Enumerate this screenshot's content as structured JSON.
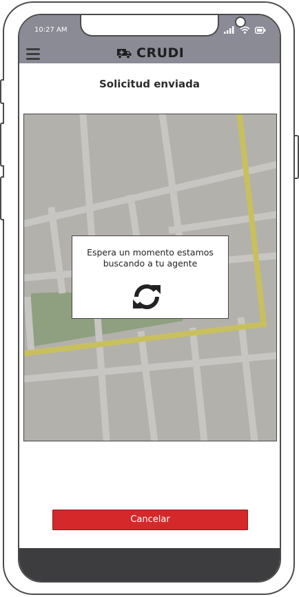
{
  "status": {
    "time": "10:27 AM"
  },
  "header": {
    "app_name": "CRUDI"
  },
  "page": {
    "title": "Solicitud enviada"
  },
  "dialog": {
    "message_line1": "Espera un momento estamos",
    "message_line2": "buscando a tu agente"
  },
  "actions": {
    "cancel_label": "Cancelar"
  },
  "colors": {
    "header_bg": "#8a8b95",
    "cancel_bg": "#d4282a",
    "bottom_bar": "#3d3d3f",
    "map_bg": "#b3b1ab",
    "road_major": "#c8c05e",
    "park": "#8ea07f"
  }
}
